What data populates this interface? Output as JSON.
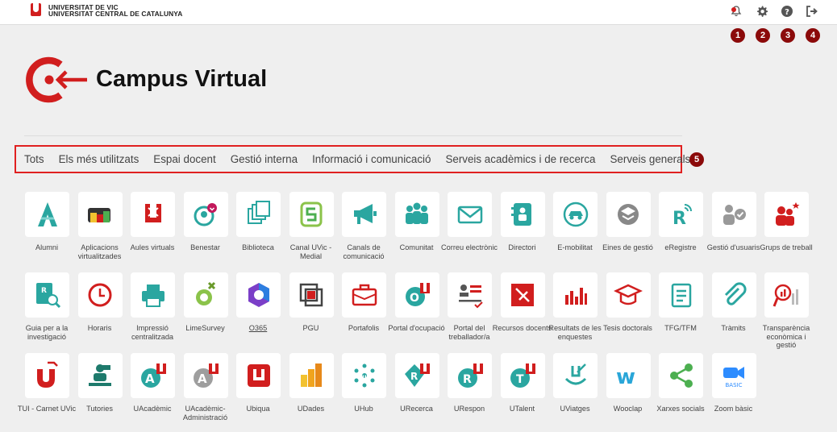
{
  "header": {
    "uni_line1": "UNIVERSITAT DE VIC",
    "uni_line2": "UNIVERSITAT CENTRAL DE CATALUNYA"
  },
  "toolbar": {
    "icons": [
      "notification-bell-icon",
      "gear-icon",
      "help-icon",
      "logout-icon"
    ],
    "badges": [
      "1",
      "2",
      "3",
      "4"
    ]
  },
  "brand": {
    "title": "Campus Virtual"
  },
  "filters": {
    "items": [
      "Tots",
      "Els més utilitzats",
      "Espai docent",
      "Gestió interna",
      "Informació i comunicació",
      "Serveis acadèmics i de recerca",
      "Serveis generals"
    ],
    "badge": "5"
  },
  "colors": {
    "accent": "#d11e1e",
    "badge": "#8b0a0a",
    "teal": "#2aa6a0"
  },
  "apps": [
    {
      "label": "Alumni",
      "icon": "alumni-icon"
    },
    {
      "label": "Aplicacions virtualitzades",
      "icon": "virtual-apps-icon"
    },
    {
      "label": "Aules virtuals",
      "icon": "virtual-classroom-icon"
    },
    {
      "label": "Benestar",
      "icon": "wellbeing-icon"
    },
    {
      "label": "Biblioteca",
      "icon": "library-icon"
    },
    {
      "label": "Canal UVic - Medial",
      "icon": "medial-icon"
    },
    {
      "label": "Canals de comunicació",
      "icon": "megaphone-icon"
    },
    {
      "label": "Comunitat",
      "icon": "community-icon"
    },
    {
      "label": "Correu electrònic",
      "icon": "mail-icon"
    },
    {
      "label": "Directori",
      "icon": "directory-icon"
    },
    {
      "label": "E-mobilitat",
      "icon": "emobility-icon"
    },
    {
      "label": "Eines de gestió",
      "icon": "management-tools-icon"
    },
    {
      "label": "eRegistre",
      "icon": "eregistre-icon"
    },
    {
      "label": "Gestió d'usuaris",
      "icon": "user-management-icon"
    },
    {
      "label": "Grups de treball",
      "icon": "work-groups-icon"
    },
    {
      "label": "Guia per a la investigació",
      "icon": "research-guide-icon"
    },
    {
      "label": "Horaris",
      "icon": "clock-icon"
    },
    {
      "label": "Impressió centralitzada",
      "icon": "printer-icon"
    },
    {
      "label": "LimeSurvey",
      "icon": "limesurvey-icon"
    },
    {
      "label": "O365",
      "icon": "office365-icon"
    },
    {
      "label": "PGU",
      "icon": "pgu-icon"
    },
    {
      "label": "Portafolis",
      "icon": "briefcase-icon"
    },
    {
      "label": "Portal d'ocupació",
      "icon": "employment-portal-icon"
    },
    {
      "label": "Portal del treballador/a",
      "icon": "worker-portal-icon"
    },
    {
      "label": "Recursos docents",
      "icon": "teaching-resources-icon"
    },
    {
      "label": "Resultats de les enquestes",
      "icon": "bar-chart-icon"
    },
    {
      "label": "Tesis doctorals",
      "icon": "graduation-cap-icon"
    },
    {
      "label": "TFG/TFM",
      "icon": "tfg-icon"
    },
    {
      "label": "Tràmits",
      "icon": "paperclip-icon"
    },
    {
      "label": "Transparència econòmica i gestió",
      "icon": "transparency-icon"
    },
    {
      "label": "TUI - Carnet UVic",
      "icon": "tui-card-icon"
    },
    {
      "label": "Tutories",
      "icon": "tutoring-icon"
    },
    {
      "label": "UAcadèmic",
      "icon": "uacademic-icon"
    },
    {
      "label": "UAcadèmic-Administració",
      "icon": "uacademic-admin-icon"
    },
    {
      "label": "Ubiqua",
      "icon": "ubiqua-icon"
    },
    {
      "label": "UDades",
      "icon": "udades-icon"
    },
    {
      "label": "UHub",
      "icon": "uhub-icon"
    },
    {
      "label": "URecerca",
      "icon": "urecerca-icon"
    },
    {
      "label": "URespon",
      "icon": "urespon-icon"
    },
    {
      "label": "UTalent",
      "icon": "utalent-icon"
    },
    {
      "label": "UViatges",
      "icon": "uviatges-icon"
    },
    {
      "label": "Wooclap",
      "icon": "wooclap-icon"
    },
    {
      "label": "Xarxes socials",
      "icon": "social-networks-icon"
    },
    {
      "label": "Zoom bàsic",
      "icon": "zoom-icon",
      "badge": "BASIC"
    }
  ]
}
